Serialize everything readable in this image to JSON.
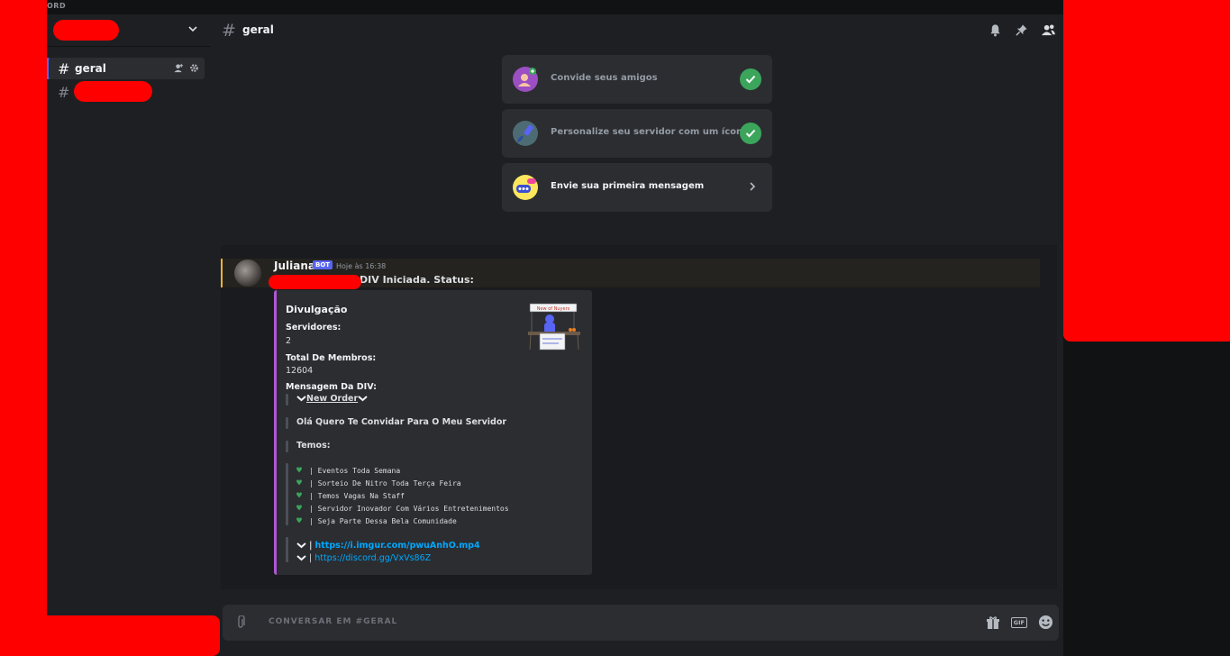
{
  "titlebar": {
    "text": "ORD"
  },
  "sidebar": {
    "channels": [
      {
        "name": "geral"
      }
    ]
  },
  "header": {
    "channel": "geral"
  },
  "checklist": [
    {
      "label": "Convide seus amigos",
      "done": true
    },
    {
      "label": "Personalize seu servidor com um ícone",
      "done": true
    },
    {
      "label": "Envie sua primeira mensagem",
      "done": false
    }
  ],
  "message": {
    "author": "Juliana",
    "badge": "BOT",
    "timestamp": "Hoje às 16:38",
    "status_text": "DIV Iniciada. Status:",
    "embed": {
      "title": "Divulgação",
      "fields": [
        {
          "name": "Servidores:",
          "value": "2"
        },
        {
          "name": "Total De Membros:",
          "value": "12604"
        },
        {
          "name": "Mensagem Da DIV:",
          "value": ""
        }
      ],
      "thumbnail_text": "New of Nuyers",
      "quote": {
        "new_order": "New Order",
        "invite": "Olá Quero Te Convidar Para O Meu Servidor",
        "temos": "Temos:",
        "items": [
          "| Eventos Toda Semana",
          "| Sorteio De Nitro Toda Terça Feira",
          "| Temos Vagas Na Staff",
          "| Servidor Inovador Com Vários Entretenimentos",
          "| Seja Parte Dessa Bela Comunidade"
        ],
        "link1": "https://i.imgur.com/pwuAnhO.mp4",
        "link2": "https://discord.gg/VxVs86Z",
        "sep": "|"
      }
    }
  },
  "composer": {
    "placeholder": "CONVERSAR EM #GERAL"
  },
  "colors": {
    "accent": "#5865f2",
    "success": "#3ba55c",
    "embed_bar": "#b056d6",
    "redaction": "#ff0000"
  }
}
